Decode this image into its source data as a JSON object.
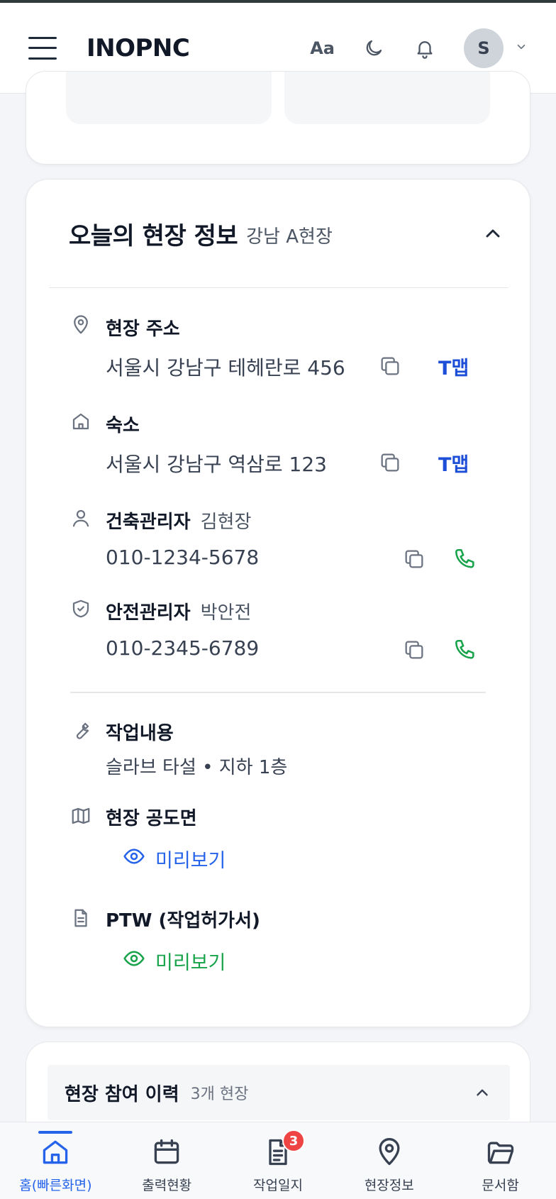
{
  "header": {
    "logo": "INOPNC",
    "font_toggle_label": "Aa",
    "avatar_initial": "S"
  },
  "site_info": {
    "title": "오늘의 현장 정보",
    "site_name": "강남 A현장",
    "address": {
      "label": "현장 주소",
      "value": "서울시 강남구 테헤란로 456",
      "tmap": "T맵"
    },
    "lodging": {
      "label": "숙소",
      "value": "서울시 강남구 역삼로 123",
      "tmap": "T맵"
    },
    "construction_manager": {
      "label": "건축관리자",
      "name": "김현장",
      "phone": "010-1234-5678"
    },
    "safety_manager": {
      "label": "안전관리자",
      "name": "박안전",
      "phone": "010-2345-6789"
    },
    "work": {
      "label": "작업내용",
      "value": "슬라브 타설 • 지하 1층"
    },
    "drawing": {
      "label": "현장 공도면",
      "preview": "미리보기"
    },
    "ptw": {
      "label": "PTW (작업허가서)",
      "preview": "미리보기"
    }
  },
  "history": {
    "title": "현장 참여 이력",
    "count": "3개 현장"
  },
  "bottom_nav": {
    "items": [
      {
        "label": "홈(빠른화면)",
        "icon": "home-icon",
        "active": true
      },
      {
        "label": "출력현황",
        "icon": "calendar-icon"
      },
      {
        "label": "작업일지",
        "icon": "document-icon",
        "badge": "3"
      },
      {
        "label": "현장정보",
        "icon": "map-pin-icon"
      },
      {
        "label": "문서함",
        "icon": "folder-icon"
      }
    ]
  },
  "colors": {
    "accent_blue": "#2563eb",
    "tmap_blue": "#1d4ed8",
    "call_green": "#16a34a",
    "badge_red": "#ef4444"
  }
}
